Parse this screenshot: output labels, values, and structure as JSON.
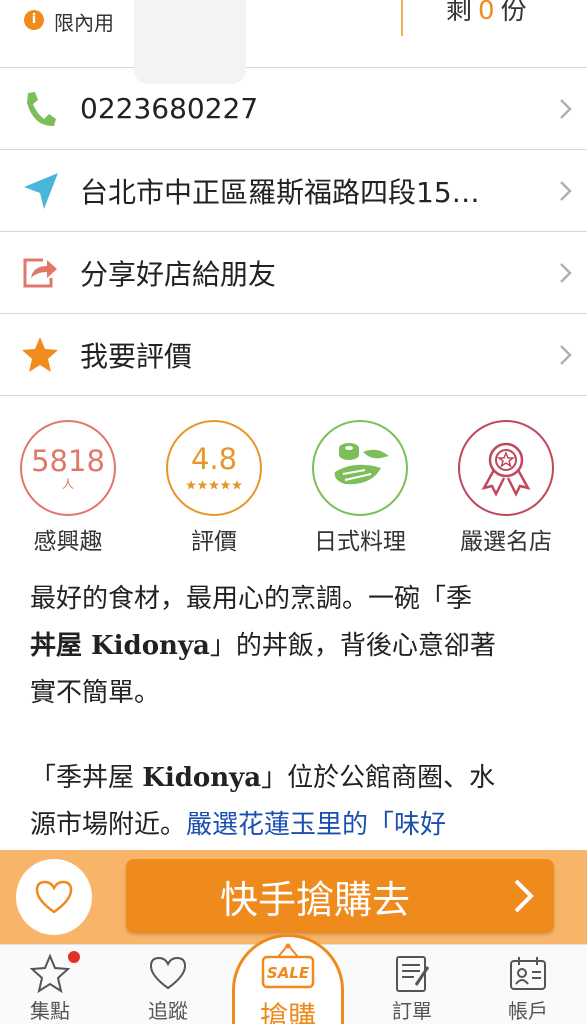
{
  "top": {
    "badge_icon": "info-icon",
    "badge_glyph": "i",
    "limit_label": "限內用",
    "remain_prefix": "剩",
    "remain_count": "0",
    "remain_suffix": "份"
  },
  "rows": [
    {
      "icon": "phone-icon",
      "text": "0223680227"
    },
    {
      "icon": "location-arrow-icon",
      "text": "台北市中正區羅斯福路四段15…"
    },
    {
      "icon": "share-icon",
      "text": "分享好店給朋友"
    },
    {
      "icon": "star-icon",
      "text": "我要評價"
    }
  ],
  "stats": {
    "interest": {
      "value": "5818",
      "unit": "人",
      "label": "感興趣",
      "color": "#e0786a"
    },
    "rating": {
      "value": "4.8",
      "stars": 5,
      "label": "評價",
      "color": "#e8962a"
    },
    "cuisine": {
      "icon": "sushi-icon",
      "label": "日式料理",
      "color": "#7cbf5a"
    },
    "award": {
      "icon": "award-ribbon-icon",
      "label": "嚴選名店",
      "color": "#c0485c"
    }
  },
  "description": {
    "p1_a": "最好的食材，最用心的烹調。一碗「季",
    "p1_b_bold": "丼屋 Kidonya",
    "p1_c": "」的丼飯，背後心意卻著",
    "p1_d": "實不簡單。",
    "p2_a": "「季丼屋 ",
    "p2_b_bold": "Kidonya",
    "p2_c": "」位於公館商圈、水",
    "p2_d": "源市場附近。",
    "p2_link": "嚴選花蓮玉里的「味好"
  },
  "buy": {
    "label": "快手搶購去"
  },
  "tabs": [
    {
      "icon": "star-outline-icon",
      "label": "集點",
      "has_dot": true
    },
    {
      "icon": "heart-outline-icon",
      "label": "追蹤"
    },
    {
      "icon": "sale-sign-icon",
      "label": "搶購",
      "sale_text": "SALE"
    },
    {
      "icon": "order-list-icon",
      "label": "訂單"
    },
    {
      "icon": "account-card-icon",
      "label": "帳戶"
    }
  ],
  "colors": {
    "accent": "#ef8a1c",
    "link": "#1a4fb0"
  }
}
